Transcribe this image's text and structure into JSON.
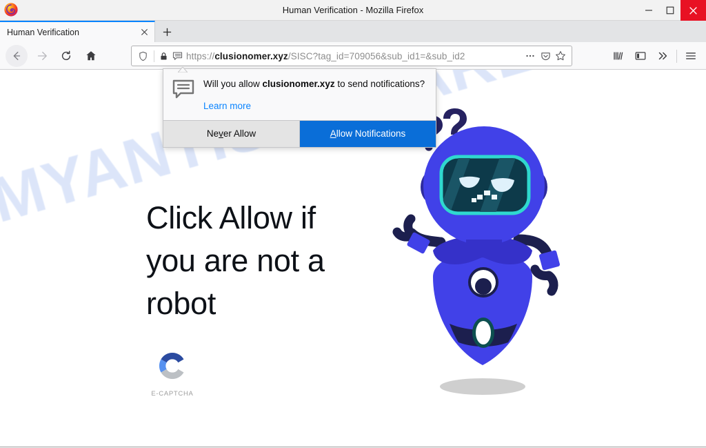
{
  "window": {
    "title": "Human Verification - Mozilla Firefox",
    "logo_icon": "firefox-logo",
    "minimize_icon": "minimize-icon",
    "maximize_icon": "maximize-icon",
    "close_icon": "close-icon"
  },
  "tabs": {
    "active": {
      "label": "Human Verification",
      "close_icon": "tab-close-icon"
    },
    "new_tab_icon": "plus-icon",
    "new_tab_label": "+"
  },
  "toolbar": {
    "back_icon": "back-arrow-icon",
    "forward_icon": "forward-arrow-icon",
    "reload_icon": "reload-icon",
    "home_icon": "home-icon",
    "shield_icon": "shield-icon",
    "lock_icon": "padlock-icon",
    "notification_permission_icon": "speech-bubble-icon",
    "page_actions_icon": "ellipsis-icon",
    "pocket_icon": "pocket-icon",
    "bookmark_icon": "star-icon",
    "library_icon": "library-icon",
    "sidebar_icon": "sidebar-icon",
    "overflow_icon": "double-chevron-right-icon",
    "menu_icon": "hamburger-menu-icon"
  },
  "url": {
    "scheme": "https://",
    "domain": "clusionomer.xyz",
    "path": "/SISC?tag_id=709056&sub_id1=&sub_id2",
    "full": "https://clusionomer.xyz/SISC?tag_id=709056&sub_id1=&sub_id2"
  },
  "permission_popup": {
    "icon": "speech-bubble-icon",
    "question_prefix": "Will you allow ",
    "question_domain": "clusionomer.xyz",
    "question_suffix": " to send notifications?",
    "learn_more": "Learn more",
    "never_allow": {
      "prefix": "Ne",
      "accesskey": "v",
      "suffix": "er Allow"
    },
    "allow": {
      "accesskey": "A",
      "suffix": "llow Notifications"
    },
    "primary_color": "#0a6ed8",
    "secondary_color": "#e4e4e4"
  },
  "page": {
    "watermark": "MYANTISPYWARE.COM",
    "headline": "Click Allow if you are not a robot",
    "captcha": {
      "logo_icon": "e-captcha-logo",
      "label": "E-CAPTCHA"
    },
    "mascot": {
      "icon": "robot-mascot-illustration",
      "question_marks": "??",
      "body_color": "#4141e8",
      "dark_color": "#1c1f4e",
      "visor_border_color": "#2fd8cf",
      "visor_fill_color": "#0d3a4a",
      "shadow_color": "#cfcfcf"
    }
  }
}
